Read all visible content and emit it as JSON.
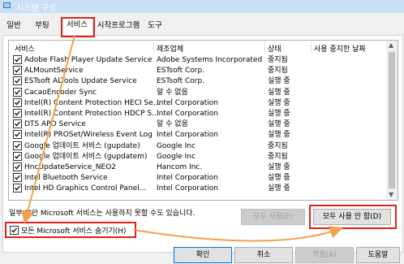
{
  "window": {
    "title": "시스템 구성"
  },
  "tabs": [
    "일반",
    "부팅",
    "서비스",
    "시작프로그램",
    "도구"
  ],
  "columns": [
    "서비스",
    "제조업체",
    "상태",
    "사용 중지한 날짜"
  ],
  "services": [
    {
      "name": "Adobe Flash Player Update Service",
      "maker": "Adobe Systems Incorporated",
      "status": "중지됨"
    },
    {
      "name": "ALMountService",
      "maker": "ESTsoft Corp.",
      "status": "중지됨"
    },
    {
      "name": "ESTsoft ALTools Update Service",
      "maker": "ESTsoft Corp.",
      "status": "실행 중"
    },
    {
      "name": "CacaoEncoder Sync",
      "maker": "알 수 없음",
      "status": "실행 중"
    },
    {
      "name": "Intel(R) Content Protection HECI Se...",
      "maker": "Intel Corporation",
      "status": "실행 중"
    },
    {
      "name": "Intel(R) Content Protection HDCP S...",
      "maker": "Intel Corporation",
      "status": "실행 중"
    },
    {
      "name": "DTS APO Service",
      "maker": "알 수 없음",
      "status": "실행 중"
    },
    {
      "name": "Intel(R) PROSet/Wireless Event Log",
      "maker": "Intel Corporation",
      "status": "실행 중"
    },
    {
      "name": "Google 업데이트 서비스 (gupdate)",
      "maker": "Google Inc",
      "status": "중지됨"
    },
    {
      "name": "Google 업데이트 서비스 (gupdatem)",
      "maker": "Google Inc",
      "status": "중지됨"
    },
    {
      "name": "HncUpdateService_NEO2",
      "maker": "Hancom Inc.",
      "status": "실행 중"
    },
    {
      "name": "Intel Bluetooth Service",
      "maker": "Intel Corporation",
      "status": "실행 중"
    },
    {
      "name": "Intel HD Graphics Control Panel...",
      "maker": "Intel Corporation",
      "status": "실행 중"
    }
  ],
  "note": "일부 보안 Microsoft 서비스는 사용하지 못할 수도 있습니다.",
  "buttons": {
    "enable_all": "모두 사용(E)",
    "disable_all": "모두 사용 안 함(D)",
    "ok": "확인",
    "cancel": "취소",
    "apply": "적용(A)",
    "help": "도움말"
  },
  "hide_ms": {
    "label": "모든 Microsoft 서비스 숨기기(H)",
    "checked": true
  },
  "colors": {
    "highlight": "#e0201c",
    "arrow": "#f4a04c"
  }
}
